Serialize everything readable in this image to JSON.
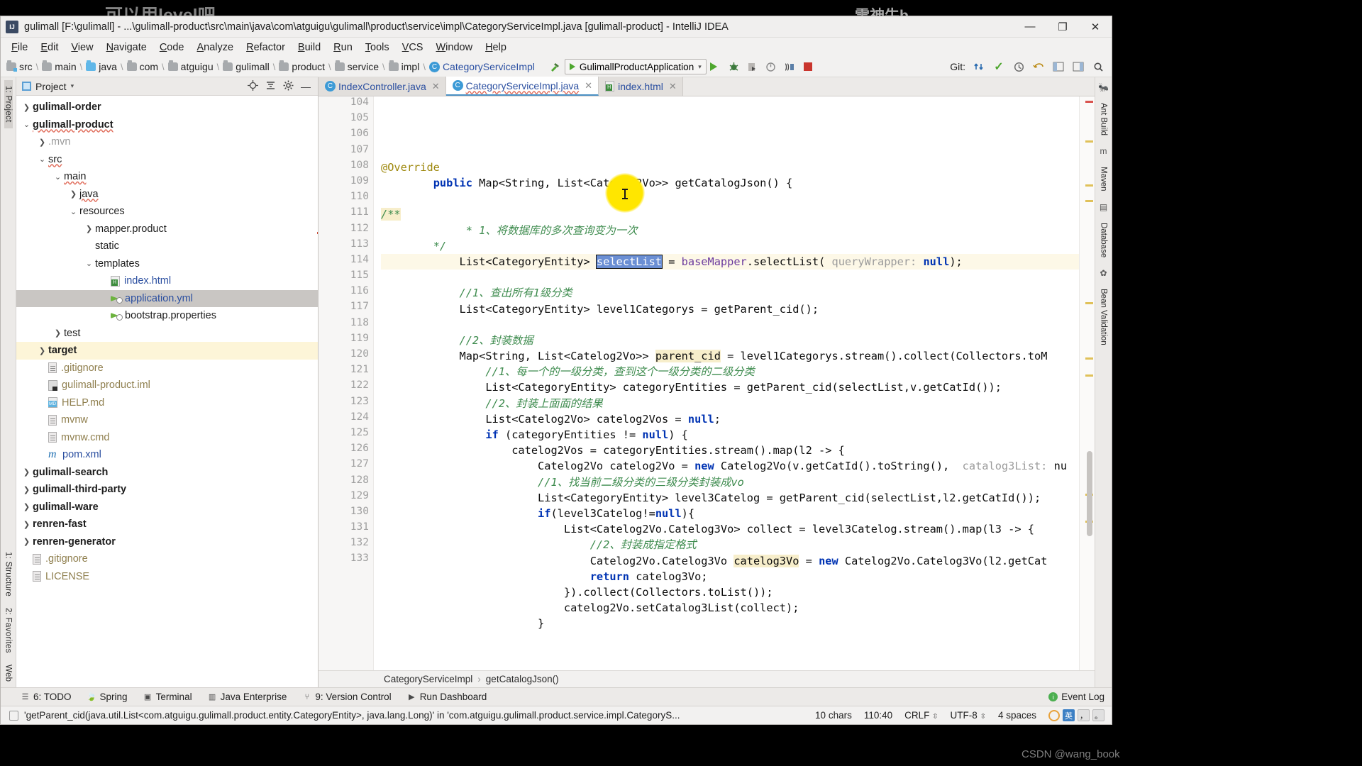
{
  "watermarks": {
    "left": "可以用level吧",
    "right": "雷神牛b",
    "bottom_right": "CSDN @wang_book"
  },
  "titlebar": {
    "title": "gulimall [F:\\gulimall] - ...\\gulimall-product\\src\\main\\java\\com\\atguigu\\gulimall\\product\\service\\impl\\CategoryServiceImpl.java [gulimall-product] - IntelliJ IDEA",
    "app_icon": "intellij-idea-icon",
    "minimize": "—",
    "maximize": "❐",
    "close": "✕"
  },
  "menu": [
    "File",
    "Edit",
    "View",
    "Navigate",
    "Code",
    "Analyze",
    "Refactor",
    "Build",
    "Run",
    "Tools",
    "VCS",
    "Window",
    "Help"
  ],
  "navbar": {
    "breadcrumbs": [
      {
        "label": "src",
        "icon": "folder-source-icon"
      },
      {
        "label": "main",
        "icon": "folder-icon"
      },
      {
        "label": "java",
        "icon": "folder-java-icon"
      },
      {
        "label": "com",
        "icon": "folder-icon"
      },
      {
        "label": "atguigu",
        "icon": "folder-icon"
      },
      {
        "label": "gulimall",
        "icon": "folder-icon"
      },
      {
        "label": "product",
        "icon": "folder-icon"
      },
      {
        "label": "service",
        "icon": "folder-icon"
      },
      {
        "label": "impl",
        "icon": "folder-icon"
      },
      {
        "label": "CategoryServiceImpl",
        "icon": "class-icon"
      }
    ],
    "run_config": "GulimallProductApplication",
    "icons": [
      "run-icon",
      "debug-icon",
      "coverage-icon",
      "profiler-icon",
      "attach-icon",
      "stop-icon"
    ],
    "git_label": "Git:",
    "git_icons": [
      "update-project-icon",
      "commit-icon",
      "history-icon",
      "rollback-icon",
      "layout-icon",
      "restore-layout-icon",
      "search-everywhere-icon"
    ]
  },
  "left_strip": {
    "tabs": [
      "1: Project",
      "1: Structure",
      "2: Favorites",
      "Web"
    ]
  },
  "right_strip": {
    "tabs": [
      "Ant Build",
      "Maven",
      "Database",
      "Bean Validation"
    ]
  },
  "project_panel": {
    "header": {
      "title": "Project",
      "icons": [
        "locate-icon",
        "collapse-all-icon",
        "settings-icon",
        "hide-icon"
      ]
    },
    "tree": [
      {
        "label": "gulimall-order",
        "indent": 0,
        "arrow": "collapsed",
        "icon": "folder-module-icon",
        "bold": true
      },
      {
        "label": "gulimall-product",
        "indent": 0,
        "arrow": "expanded",
        "icon": "folder-module-icon",
        "bold": true,
        "squiggle": true
      },
      {
        "label": ".mvn",
        "indent": 1,
        "arrow": "collapsed",
        "icon": "folder-icon",
        "dim": true
      },
      {
        "label": "src",
        "indent": 1,
        "arrow": "expanded",
        "icon": "folder-icon",
        "squiggle": true
      },
      {
        "label": "main",
        "indent": 2,
        "arrow": "expanded",
        "icon": "folder-icon",
        "squiggle": true
      },
      {
        "label": "java",
        "indent": 3,
        "arrow": "collapsed",
        "icon": "folder-java-icon",
        "squiggle": true
      },
      {
        "label": "resources",
        "indent": 3,
        "arrow": "expanded",
        "icon": "folder-resources-icon"
      },
      {
        "label": "mapper.product",
        "indent": 4,
        "arrow": "collapsed",
        "icon": "folder-package-icon"
      },
      {
        "label": "static",
        "indent": 4,
        "arrow": "none",
        "icon": "folder-package-icon"
      },
      {
        "label": "templates",
        "indent": 4,
        "arrow": "expanded",
        "icon": "folder-package-icon"
      },
      {
        "label": "index.html",
        "indent": 5,
        "arrow": "none",
        "icon": "html-file-icon",
        "color": "blue"
      },
      {
        "label": "application.yml",
        "indent": 5,
        "arrow": "none",
        "icon": "spring-yaml-icon",
        "color": "blue",
        "state": "selected"
      },
      {
        "label": "bootstrap.properties",
        "indent": 5,
        "arrow": "none",
        "icon": "spring-properties-icon"
      },
      {
        "label": "test",
        "indent": 2,
        "arrow": "collapsed",
        "icon": "folder-icon"
      },
      {
        "label": "target",
        "indent": 1,
        "arrow": "collapsed",
        "icon": "folder-excluded-icon",
        "bold": true,
        "state": "highlighted"
      },
      {
        "label": ".gitignore",
        "indent": 1,
        "arrow": "none",
        "icon": "text-file-icon",
        "color": "tan"
      },
      {
        "label": "gulimall-product.iml",
        "indent": 1,
        "arrow": "none",
        "icon": "iml-file-icon",
        "color": "tan"
      },
      {
        "label": "HELP.md",
        "indent": 1,
        "arrow": "none",
        "icon": "markdown-file-icon",
        "color": "tan"
      },
      {
        "label": "mvnw",
        "indent": 1,
        "arrow": "none",
        "icon": "text-file-icon",
        "color": "tan"
      },
      {
        "label": "mvnw.cmd",
        "indent": 1,
        "arrow": "none",
        "icon": "text-file-icon",
        "color": "tan"
      },
      {
        "label": "pom.xml",
        "indent": 1,
        "arrow": "none",
        "icon": "maven-pom-icon",
        "color": "blue"
      },
      {
        "label": "gulimall-search",
        "indent": 0,
        "arrow": "collapsed",
        "icon": "folder-module-icon",
        "bold": true
      },
      {
        "label": "gulimall-third-party",
        "indent": 0,
        "arrow": "collapsed",
        "icon": "folder-module-icon",
        "bold": true
      },
      {
        "label": "gulimall-ware",
        "indent": 0,
        "arrow": "collapsed",
        "icon": "folder-module-icon",
        "bold": true
      },
      {
        "label": "renren-fast",
        "indent": 0,
        "arrow": "collapsed",
        "icon": "folder-module-icon",
        "bold": true
      },
      {
        "label": "renren-generator",
        "indent": 0,
        "arrow": "collapsed",
        "icon": "folder-module-icon",
        "bold": true
      },
      {
        "label": ".gitignore",
        "indent": 0,
        "arrow": "none",
        "icon": "text-file-icon",
        "color": "tan"
      },
      {
        "label": "LICENSE",
        "indent": 0,
        "arrow": "none",
        "icon": "text-file-icon",
        "color": "tan"
      }
    ]
  },
  "editor": {
    "tabs": [
      {
        "label": "IndexController.java",
        "icon": "class-icon",
        "active": false,
        "closable": true
      },
      {
        "label": "CategoryServiceImpl.java",
        "icon": "class-icon",
        "active": true,
        "closable": true,
        "squiggle": true
      },
      {
        "label": "index.html",
        "icon": "html-file-icon",
        "active": false,
        "closable": true
      }
    ],
    "first_line_number": 104,
    "lines": [
      {
        "n": 104,
        "text": "        @Override"
      },
      {
        "n": 105,
        "text": "        public Map<String, List<Catelog2Vo>> getCatalogJson() {",
        "markers": [
          "implementing-method-icon",
          "overriding-method-icon"
        ],
        "fold": true
      },
      {
        "n": 106,
        "text": ""
      },
      {
        "n": 107,
        "text": "            /**",
        "fold": true
      },
      {
        "n": 108,
        "text": "             * 1、将数据库的多次查询变为一次"
      },
      {
        "n": 109,
        "text": "             */",
        "fold": true
      },
      {
        "n": 110,
        "text": "            List<CategoryEntity> selectList = baseMapper.selectList( queryWrapper: null);",
        "current": true
      },
      {
        "n": 111,
        "text": ""
      },
      {
        "n": 112,
        "text": "            //1、查出所有1级分类"
      },
      {
        "n": 113,
        "text": "            List<CategoryEntity> level1Categorys = getParent_cid();"
      },
      {
        "n": 114,
        "text": ""
      },
      {
        "n": 115,
        "text": "            //2、封装数据"
      },
      {
        "n": 116,
        "text": "            Map<String, List<Catelog2Vo>> parent_cid = level1Categorys.stream().collect(Collectors.toM",
        "markers": [
          "overriding-method-icon"
        ],
        "fold": true
      },
      {
        "n": 117,
        "text": "                //1、每一个的一级分类，查到这个一级分类的二级分类"
      },
      {
        "n": 118,
        "text": "                List<CategoryEntity> categoryEntities = getParent_cid(selectList,v.getCatId());"
      },
      {
        "n": 119,
        "text": "                //2、封装上面面的结果"
      },
      {
        "n": 120,
        "text": "                List<Catelog2Vo> catelog2Vos = null;"
      },
      {
        "n": 121,
        "text": "                if (categoryEntities != null) {"
      },
      {
        "n": 122,
        "text": "                    catelog2Vos = categoryEntities.stream().map(l2 -> {",
        "markers": [
          "overriding-method-icon"
        ],
        "fold": true
      },
      {
        "n": 123,
        "text": "                        Catelog2Vo catelog2Vo = new Catelog2Vo(v.getCatId().toString(),  catalog3List: nu"
      },
      {
        "n": 124,
        "text": "                        //1、找当前二级分类的三级分类封装成vo"
      },
      {
        "n": 125,
        "text": "                        List<CategoryEntity> level3Catelog = getParent_cid(selectList,l2.getCatId());"
      },
      {
        "n": 126,
        "text": "                        if(level3Catelog!=null){"
      },
      {
        "n": 127,
        "text": "                            List<Catelog2Vo.Catelog3Vo> collect = level3Catelog.stream().map(l3 -> {",
        "markers": [
          "overriding-method-icon"
        ],
        "fold": true
      },
      {
        "n": 128,
        "text": "                                //2、封装成指定格式"
      },
      {
        "n": 129,
        "text": "                                Catelog2Vo.Catelog3Vo catelog3Vo = new Catelog2Vo.Catelog3Vo(l2.getCat"
      },
      {
        "n": 130,
        "text": "                                return catelog3Vo;"
      },
      {
        "n": 131,
        "text": "                            }).collect(Collectors.toList());"
      },
      {
        "n": 132,
        "text": "                            catelog2Vo.setCatalog3List(collect);"
      },
      {
        "n": 133,
        "text": "                        }"
      }
    ],
    "selected_token": "selectList",
    "breadcrumb": [
      "CategoryServiceImpl",
      "getCatalogJson()"
    ]
  },
  "toolwindow_bar": {
    "items": [
      {
        "label": "6: TODO",
        "icon": "todo-icon"
      },
      {
        "label": "Spring",
        "icon": "spring-leaf-icon"
      },
      {
        "label": "Terminal",
        "icon": "terminal-icon"
      },
      {
        "label": "Java Enterprise",
        "icon": "java-enterprise-icon"
      },
      {
        "label": "9: Version Control",
        "icon": "version-control-icon"
      },
      {
        "label": "Run Dashboard",
        "icon": "run-dashboard-icon"
      }
    ],
    "event_log": "Event Log"
  },
  "statusbar": {
    "message": "'getParent_cid(java.util.List<com.atguigu.gulimall.product.entity.CategoryEntity>, java.lang.Long)' in 'com.atguigu.gulimall.product.service.impl.CategoryS...",
    "chars": "10 chars",
    "caret": "110:40",
    "line_separator": "CRLF",
    "encoding": "UTF-8",
    "indent": "4 spaces",
    "ime": [
      "英",
      "，",
      "。"
    ]
  },
  "colors": {
    "accent_blue": "#2b4fa0",
    "selection_blue": "#6b8fd4",
    "keyword_blue": "#0033b3",
    "comment_green": "#3f8c4f",
    "highlight_yellow": "#ffe600",
    "current_line": "#fdf8e7",
    "panel_bg": "#f2f1f0"
  }
}
